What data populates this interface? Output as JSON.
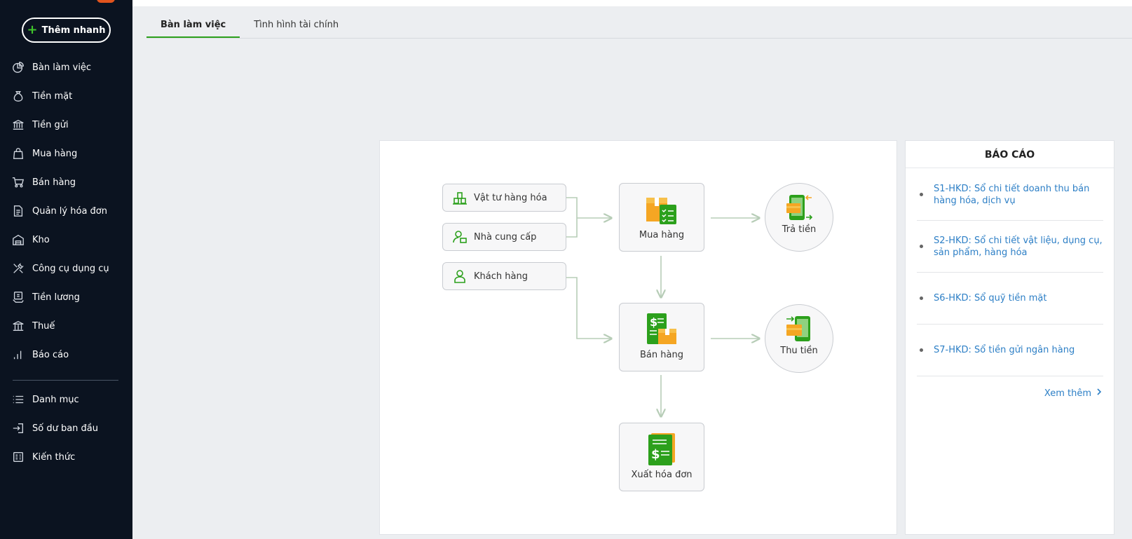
{
  "sidebar": {
    "quick_add_label": "Thêm nhanh",
    "items": [
      {
        "label": "Bàn làm việc",
        "icon": "dashboard-icon"
      },
      {
        "label": "Tiền mặt",
        "icon": "money-bag-icon"
      },
      {
        "label": "Tiền gửi",
        "icon": "bank-icon"
      },
      {
        "label": "Mua hàng",
        "icon": "shopping-bag-icon"
      },
      {
        "label": "Bán hàng",
        "icon": "cart-icon"
      },
      {
        "label": "Quản lý hóa đơn",
        "icon": "document-icon"
      },
      {
        "label": "Kho",
        "icon": "warehouse-icon"
      },
      {
        "label": "Công cụ dụng cụ",
        "icon": "tools-icon"
      },
      {
        "label": "Tiền lương",
        "icon": "payroll-icon"
      },
      {
        "label": "Thuế",
        "icon": "tax-building-icon"
      },
      {
        "label": "Báo cáo",
        "icon": "bar-chart-icon"
      },
      {
        "label": "Danh mục",
        "icon": "list-icon"
      },
      {
        "label": "Số dư ban đầu",
        "icon": "login-icon"
      },
      {
        "label": "Kiến thức",
        "icon": "book-icon"
      }
    ]
  },
  "tabs": [
    {
      "label": "Bàn làm việc",
      "active": true
    },
    {
      "label": "Tình hình tài chính",
      "active": false
    }
  ],
  "workflow": {
    "chips": [
      {
        "label": "Vật tư hàng hóa",
        "icon": "goods-icon"
      },
      {
        "label": "Nhà cung cấp",
        "icon": "supplier-icon"
      },
      {
        "label": "Khách hàng",
        "icon": "customer-icon"
      }
    ],
    "boxes": {
      "purchase": "Mua hàng",
      "sales": "Bán hàng",
      "invoice": "Xuất hóa đơn"
    },
    "circles": {
      "pay": "Trả tiền",
      "collect": "Thu tiền"
    }
  },
  "report": {
    "title": "BÁO CÁO",
    "items": [
      "S1-HKD: Sổ chi tiết doanh thu bán hàng hóa, dịch vụ",
      "S2-HKD: Sổ chi tiết vật liệu, dụng cụ, sản phẩm, hàng hóa",
      "S6-HKD: Sổ quỹ tiền mặt",
      "S7-HKD: Sổ tiền gửi ngân hàng"
    ],
    "see_more": "Xem thêm"
  },
  "colors": {
    "sidebar_bg": "#0b1320",
    "accent_green": "#2ca01c",
    "link_blue": "#2d7fc6",
    "icon_orange": "#f5a623"
  }
}
